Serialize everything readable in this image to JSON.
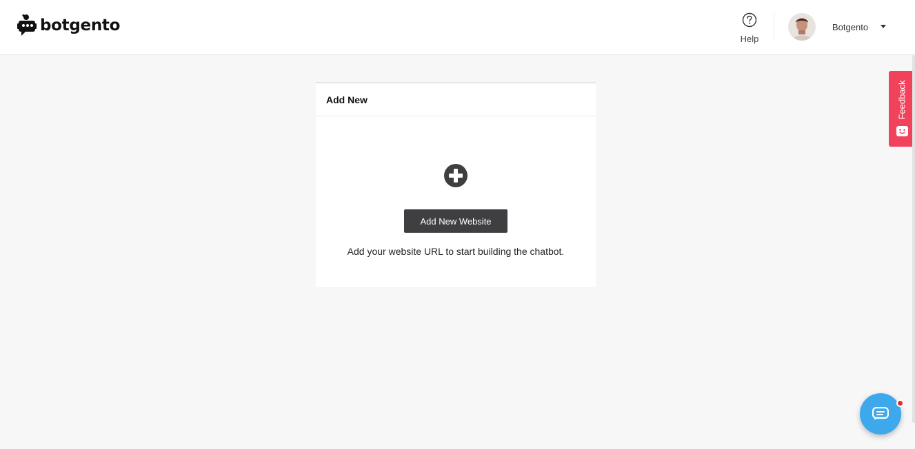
{
  "header": {
    "brand": "botgento",
    "help_label": "Help",
    "user_name": "Botgento"
  },
  "card": {
    "title": "Add New",
    "button_label": "Add New Website",
    "hint": "Add your website URL to start building the chatbot."
  },
  "feedback": {
    "label": "Feedback"
  },
  "icons": {
    "logo": "robot-chat-icon",
    "help": "question-circle-icon",
    "add": "plus-circle-icon",
    "feedback": "smiley-icon",
    "chat": "chat-bubble-icon"
  },
  "colors": {
    "button_bg": "#3f3f42",
    "feedback_bg": "#f2415a",
    "chat_bg": "#3ea8ec",
    "notification_dot": "#e82b2b"
  }
}
